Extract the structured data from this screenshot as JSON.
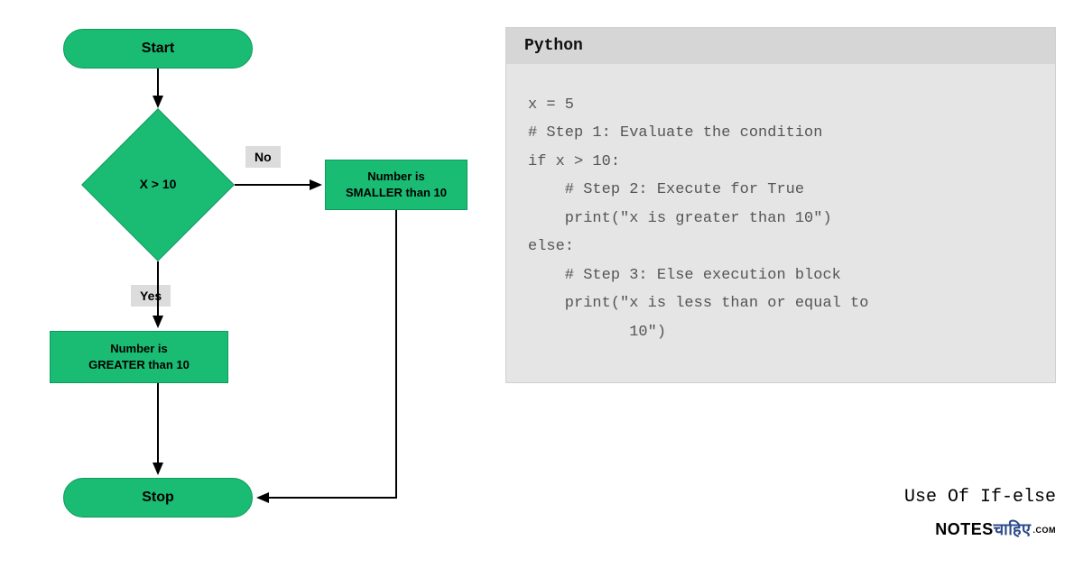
{
  "flowchart": {
    "start": "Start",
    "stop": "Stop",
    "decision": "X > 10",
    "yes_label": "Yes",
    "no_label": "No",
    "greater_box": "Number is\nGREATER than 10",
    "smaller_box": "Number is\nSMALLER than 10"
  },
  "code": {
    "language": "Python",
    "lines": "x = 5\n# Step 1: Evaluate the condition\nif x > 10:\n    # Step 2: Execute for True\n    print(\"x is greater than 10\")\nelse:\n    # Step 3: Else execution block\n    print(\"x is less than or equal to\n           10\")"
  },
  "caption": "Use Of If-else",
  "brand": {
    "text1": "NOTES",
    "text2": "चाहिए",
    "text3": ".COM"
  },
  "colors": {
    "node": "#1abc74",
    "panel": "#e5e5e5",
    "header": "#d6d6d6"
  }
}
